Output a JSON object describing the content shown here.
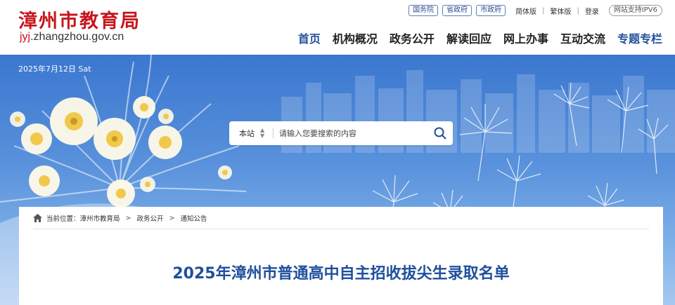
{
  "site": {
    "title": "漳州市教育局",
    "domain_prefix": "jyj",
    "domain_rest": ".zhangzhou.gov.cn"
  },
  "top_links": {
    "gov_links": [
      "国务院",
      "省政府",
      "市政府"
    ],
    "simplified": "简体版",
    "traditional": "繁体版",
    "login": "登录",
    "ipv6": "网站支持IPV6"
  },
  "nav": {
    "items": [
      "首页",
      "机构概况",
      "政务公开",
      "解读回应",
      "网上办事",
      "互动交流",
      "专题专栏"
    ],
    "active_index": 0
  },
  "banner": {
    "date": "2025年7月12日 Sat"
  },
  "search": {
    "scope": "本站",
    "placeholder": "请输入您要搜索的内容"
  },
  "breadcrumb": {
    "label": "当前位置：",
    "items": [
      "漳州市教育局",
      "政务公开",
      "通知公告"
    ],
    "separator": ">"
  },
  "article": {
    "title": "2025年漳州市普通高中自主招收拔尖生录取名单"
  },
  "colors": {
    "brand_red": "#c8161d",
    "brand_blue": "#1f4f9c",
    "banner_top": "#3a77cf",
    "banner_bottom": "#a6c8f0"
  }
}
